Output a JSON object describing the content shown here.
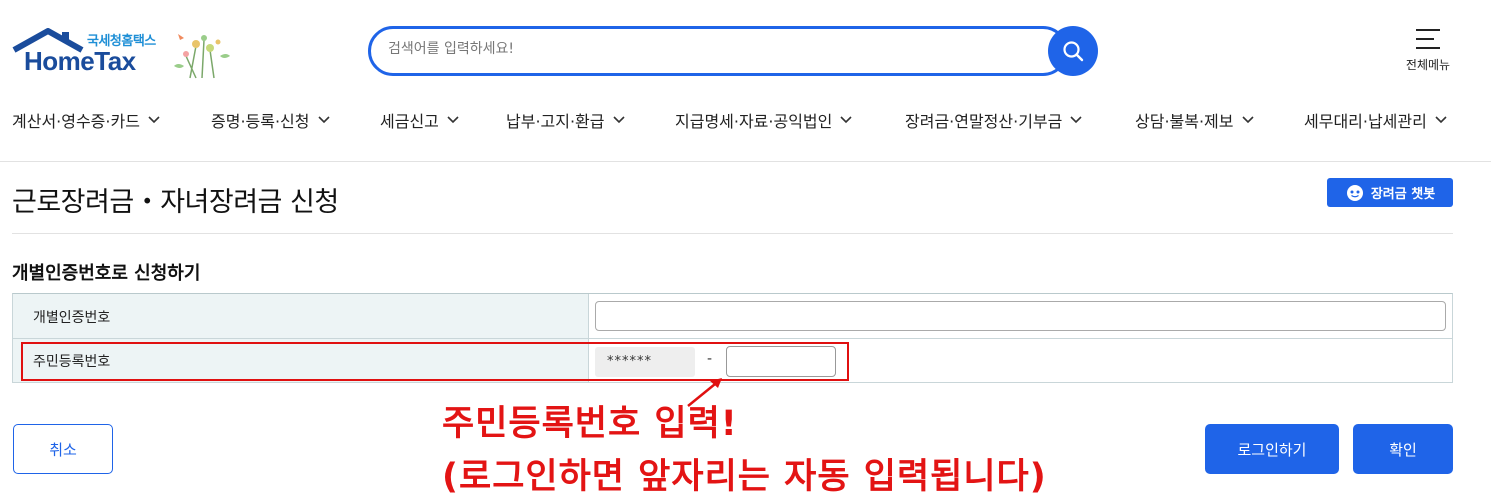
{
  "header": {
    "logo_sub": "국세청홈택스",
    "logo_main": "HomeTax",
    "search_placeholder": "검색어를 입력하세요!",
    "all_menu_label": "전체메뉴"
  },
  "nav": {
    "items": [
      {
        "label": "계산서·영수증·카드"
      },
      {
        "label": "증명·등록·신청"
      },
      {
        "label": "세금신고"
      },
      {
        "label": "납부·고지·환급"
      },
      {
        "label": "지급명세·자료·공익법인"
      },
      {
        "label": "장려금·연말정산·기부금"
      },
      {
        "label": "상담·불복·제보"
      },
      {
        "label": "세무대리·납세관리"
      }
    ]
  },
  "page": {
    "title": "근로장려금・자녀장려금 신청",
    "chatbot_label": "장려금 챗봇",
    "section_title": "개별인증번호로 신청하기"
  },
  "form": {
    "cert_label": "개별인증번호",
    "cert_value": "",
    "rrn_label": "주민등록번호",
    "rrn_front": "******",
    "rrn_dash": "-",
    "rrn_back": ""
  },
  "annotation": {
    "line1": "주민등록번호 입력!",
    "line2": "(로그인하면 앞자리는 자동 입력됩니다)"
  },
  "buttons": {
    "cancel": "취소",
    "login": "로그인하기",
    "confirm": "확인"
  },
  "colors": {
    "primary": "#1f64e8",
    "annotation_red": "#e31414",
    "label_bg": "#edf4f5"
  }
}
